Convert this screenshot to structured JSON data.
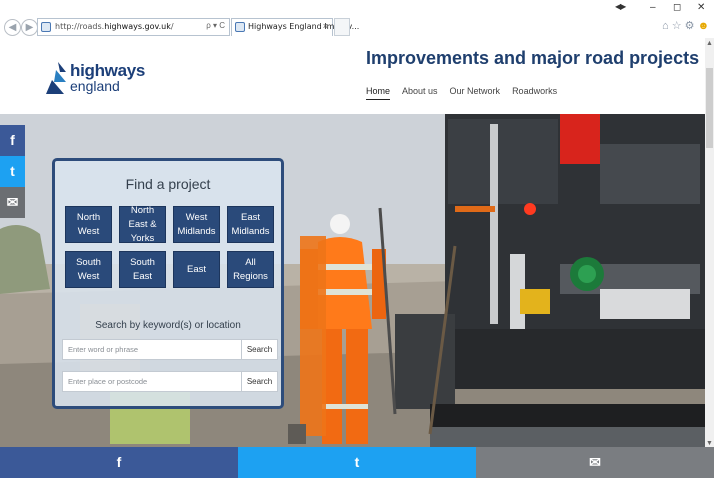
{
  "browser": {
    "url_prefix": "http://roads.",
    "url_domain": "highways.gov.uk",
    "url_suffix": "/",
    "address_tools": "ρ ▾ C",
    "tab_title": "Highways England Improv...",
    "tab_close": "×",
    "back_glyph": "◀",
    "forward_glyph": "▶",
    "window_controls": {
      "restore": "◀▶",
      "minimize": "–",
      "maximize": "◻",
      "close": "✕"
    },
    "toolbar_icons": {
      "home": "⌂",
      "favorites": "☆",
      "settings": "⚙",
      "feedback": "☻"
    }
  },
  "header": {
    "logo_line1": "highways",
    "logo_line2": "england",
    "page_title": "Improvements and major road projects",
    "nav": [
      {
        "label": "Home",
        "active": true
      },
      {
        "label": "About us",
        "active": false
      },
      {
        "label": "Our Network",
        "active": false
      },
      {
        "label": "Roadworks",
        "active": false
      }
    ]
  },
  "social_rail": {
    "facebook": "f",
    "twitter": "t",
    "email": "✉"
  },
  "finder": {
    "title": "Find a project",
    "regions": [
      "North West",
      "North East & Yorks",
      "West Midlands",
      "East Midlands",
      "South West",
      "South East",
      "East",
      "All Regions"
    ],
    "keyword_heading": "Search by keyword(s) or location",
    "keyword_placeholder": "Enter word or phrase",
    "keyword_button": "Search",
    "location_placeholder": "Enter place or postcode",
    "location_button": "Search"
  },
  "share_bar": {
    "facebook": "f",
    "twitter": "t",
    "email": "✉"
  },
  "colors": {
    "brand_navy": "#2a4a7a",
    "facebook": "#3b5998",
    "twitter": "#1da1f2",
    "email": "#7a7d81"
  }
}
